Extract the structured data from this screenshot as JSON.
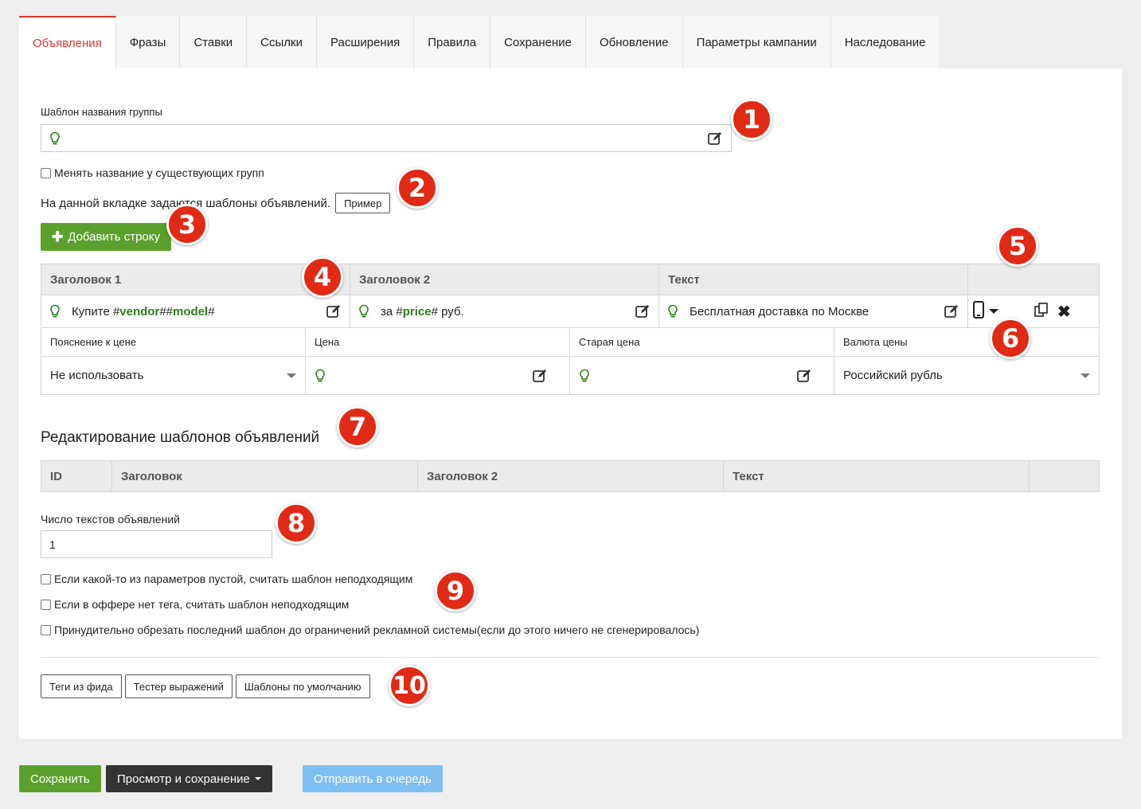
{
  "tabs": [
    {
      "label": "Объявления",
      "active": true
    },
    {
      "label": "Фразы"
    },
    {
      "label": "Ставки"
    },
    {
      "label": "Ссылки"
    },
    {
      "label": "Расширения"
    },
    {
      "label": "Правила"
    },
    {
      "label": "Сохранение"
    },
    {
      "label": "Обновление"
    },
    {
      "label": "Параметры кампании"
    },
    {
      "label": "Наследование"
    }
  ],
  "group_name": {
    "label": "Шаблон названия группы",
    "value": ""
  },
  "rename_existing": {
    "label": "Менять название у существующих групп",
    "checked": false
  },
  "info": {
    "text": "На данной вкладке задаются шаблоны объявлений.",
    "example_button": "Пример"
  },
  "add_row_button": "Добавить строку",
  "ads_grid": {
    "headers": [
      "Заголовок 1",
      "Заголовок 2",
      "Текст"
    ],
    "row": {
      "title1": {
        "prefix": "Купите #",
        "var1": "vendor",
        "mid": "##",
        "var2": "model",
        "suffix": "#"
      },
      "title2": {
        "prefix": "за #",
        "var1": "price",
        "suffix": "# руб."
      },
      "text": "Бесплатная доставка по Москве"
    },
    "sub_headers": [
      "Пояснение к цене",
      "Цена",
      "Старая цена",
      "Валюта цены"
    ],
    "sub_values": {
      "price_note": "Не использовать",
      "price": "",
      "old_price": "",
      "currency": "Российский рубль"
    }
  },
  "edit_section": {
    "title": "Редактирование шаблонов объявлений",
    "headers": [
      "ID",
      "Заголовок",
      "Заголовок 2",
      "Текст"
    ]
  },
  "ad_count": {
    "label": "Число текстов объявлений",
    "value": "1"
  },
  "options": [
    {
      "label": "Если какой-то из параметров пустой, считать шаблон неподходящим",
      "checked": false
    },
    {
      "label": "Если в оффере нет тега, считать шаблон неподходящим",
      "checked": false
    },
    {
      "label": "Принудительно обрезать последний шаблон до ограничений рекламной системы(если до этого ничего не сгенерировалось)",
      "checked": false
    }
  ],
  "tool_buttons": [
    "Теги из фида",
    "Тестер выражений",
    "Шаблоны по умолчанию"
  ],
  "bottom": {
    "save": "Сохранить",
    "preview_save": "Просмотр и сохранение",
    "queue": "Отправить в очередь"
  },
  "markers": [
    "1",
    "2",
    "3",
    "4",
    "5",
    "6",
    "7",
    "8",
    "9",
    "10"
  ],
  "colors": {
    "accent": "#d9372b",
    "green": "#5ba02c",
    "marker": "#e02a15",
    "queue": "#7fbef0",
    "dark": "#333333"
  }
}
